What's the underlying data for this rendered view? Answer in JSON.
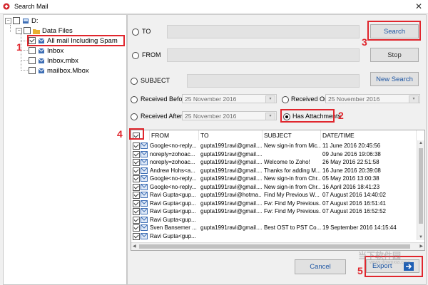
{
  "window": {
    "title": "Search Mail",
    "close_glyph": "✕"
  },
  "tree": {
    "root": {
      "label": "D:"
    },
    "folder": {
      "label": "Data Files"
    },
    "items": [
      {
        "label": "All mail Including Spam",
        "checked": true
      },
      {
        "label": "Inbox",
        "checked": false
      },
      {
        "label": "Inbox.mbx",
        "checked": false
      },
      {
        "label": "mailbox.Mbox",
        "checked": false
      }
    ]
  },
  "search": {
    "to_label": "TO",
    "from_label": "FROM",
    "subject_label": "SUBJECT",
    "received_before_label": "Received Before",
    "received_on_label": "Received On",
    "received_after_label": "Received After",
    "has_attachments_label": "Has Attachments",
    "received_before_value": "25 November 2016",
    "received_on_value": "25 November 2016",
    "received_after_value": "25 November 2016"
  },
  "buttons": {
    "search": "Search",
    "stop": "Stop",
    "new_search": "New Search",
    "cancel": "Cancel",
    "export": "Export"
  },
  "annotations": [
    "1",
    "2",
    "3",
    "4",
    "5"
  ],
  "grid": {
    "columns": [
      "FROM",
      "TO",
      "SUBJECT",
      "DATE/TIME"
    ],
    "rows": [
      {
        "from": "Google<no-reply...",
        "to": "gupta1991ravi@gmail....",
        "subject": "New sign-in from Mic...",
        "date": "11 June 2016 20:45:56"
      },
      {
        "from": "noreply=zohoac...",
        "to": "gupta1991ravi@gmail....",
        "subject": "",
        "date": "09 June 2016 19:06:38"
      },
      {
        "from": "noreply=zohoac...",
        "to": "gupta1991ravi@gmail....",
        "subject": "Welcome to Zoho!",
        "date": "26 May 2016 22:51:58"
      },
      {
        "from": "Andrew Hohs<a...",
        "to": "gupta1991ravi@gmail....",
        "subject": "Thanks for adding M...",
        "date": "16 June 2016 20:39:08"
      },
      {
        "from": "Google<no-reply...",
        "to": "gupta1991ravi@gmail....",
        "subject": "New sign-in from Chr...",
        "date": "05 May 2016 13:00:38"
      },
      {
        "from": "Google<no-reply...",
        "to": "gupta1991ravi@gmail....",
        "subject": "New sign-in from Chr...",
        "date": "16 April 2016 18:41:23"
      },
      {
        "from": "Ravi Gupta<gup...",
        "to": "gupta1991ravi@hotma...",
        "subject": "Find My Previous W...",
        "date": "07 August 2016 14:40:02"
      },
      {
        "from": "Ravi Gupta<gup...",
        "to": "gupta1991ravi@gmail....",
        "subject": "Fw: Find My Previous...",
        "date": "07 August 2016 16:51:41"
      },
      {
        "from": "Ravi Gupta<gup...",
        "to": "gupta1991ravi@gmail....",
        "subject": "Fw: Find My Previous...",
        "date": "07 August 2016 16:52:52"
      },
      {
        "from": "Ravi Gupta<gup...",
        "to": "",
        "subject": "",
        "date": ""
      },
      {
        "from": "Sven Bansemer ...",
        "to": "gupta1991ravi@gmail....",
        "subject": "Best OST to PST Co...",
        "date": "19 September 2016 14:15:44"
      },
      {
        "from": "Ravi Gupta<gup...",
        "to": "",
        "subject": "",
        "date": ""
      }
    ]
  },
  "watermark": {
    "line1": "当下软件园",
    "line2": "www.downxia.com"
  },
  "colors": {
    "accent": "#1f57a4",
    "annotation": "#e0262d"
  }
}
